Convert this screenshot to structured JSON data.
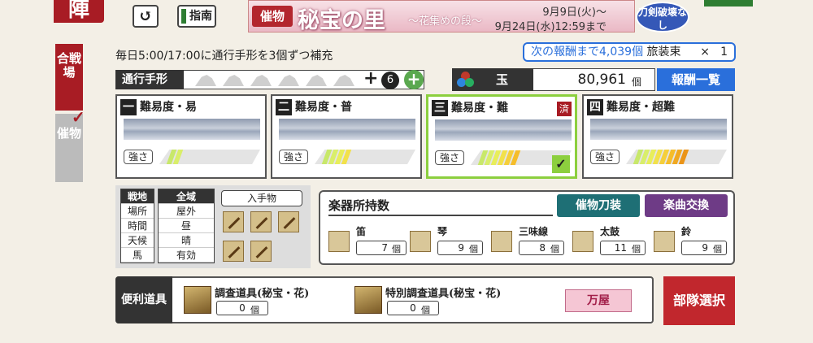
{
  "header": {
    "jin_label": "陣",
    "back_symbol": "↺",
    "guide_label": "指南",
    "banner": {
      "tag": "催物",
      "title": "秘宝の里",
      "subtitle": "〜花集めの段〜",
      "date_start": "9月9日(火)〜",
      "date_end": "9月24日(水)12:59まで"
    },
    "badge": "刀剣破壊なし"
  },
  "side_tabs": {
    "gosenjo": "合戦場",
    "saibutsu": "催物",
    "checkmark": "✓"
  },
  "supply_note": "毎日5:00/17:00に通行手形を3個ずつ補充",
  "next_reward": {
    "label_prefix": "次の報酬まで4,039個",
    "item": "旅装束",
    "multiplier": "×",
    "count": "1"
  },
  "pass": {
    "label": "通行手形",
    "plus": "+",
    "extra_count": "6",
    "add": "+"
  },
  "tama": {
    "label": "玉",
    "value": "80,961",
    "unit": "個",
    "reward_list_button": "報酬一覧"
  },
  "difficulties": [
    {
      "num": "一",
      "title": "難易度・易",
      "strength_label": "強さ",
      "level": 0.15,
      "completed": false,
      "selected": false
    },
    {
      "num": "二",
      "title": "難易度・普",
      "strength_label": "強さ",
      "level": 0.3,
      "completed": false,
      "selected": false
    },
    {
      "num": "三",
      "title": "難易度・難",
      "strength_label": "強さ",
      "level": 0.45,
      "completed": true,
      "completed_label": "済",
      "selected": true,
      "selected_mark": "✓"
    },
    {
      "num": "四",
      "title": "難易度・超難",
      "strength_label": "強さ",
      "level": 0.6,
      "completed": false,
      "selected": false
    }
  ],
  "conditions": {
    "col1": [
      "戦地",
      "場所",
      "時間",
      "天候",
      "馬"
    ],
    "col2": [
      "全域",
      "屋外",
      "昼",
      "晴",
      "有効"
    ],
    "acquire_title": "入手物"
  },
  "instruments": {
    "title": "楽器所持数",
    "btn_costume": "催物刀装",
    "btn_exchange": "楽曲交換",
    "items": [
      {
        "name": "笛",
        "count": "7",
        "unit": "個"
      },
      {
        "name": "琴",
        "count": "9",
        "unit": "個"
      },
      {
        "name": "三味線",
        "count": "8",
        "unit": "個"
      },
      {
        "name": "太鼓",
        "count": "11",
        "unit": "個"
      },
      {
        "name": "鈴",
        "count": "9",
        "unit": "個"
      }
    ]
  },
  "tools": {
    "label": "便利道具",
    "items": [
      {
        "name": "調査道具(秘宝・花)",
        "count": "0",
        "unit": "個"
      },
      {
        "name": "特別調査道具(秘宝・花)",
        "count": "0",
        "unit": "個"
      }
    ],
    "shop_button": "万屋",
    "deploy_button": "部隊選択"
  },
  "colors": {
    "accent_red": "#a81c24",
    "blue": "#2a6fdb",
    "selected_green": "#8ccf3e",
    "teal": "#1e6f75",
    "purple": "#6e3b86"
  }
}
